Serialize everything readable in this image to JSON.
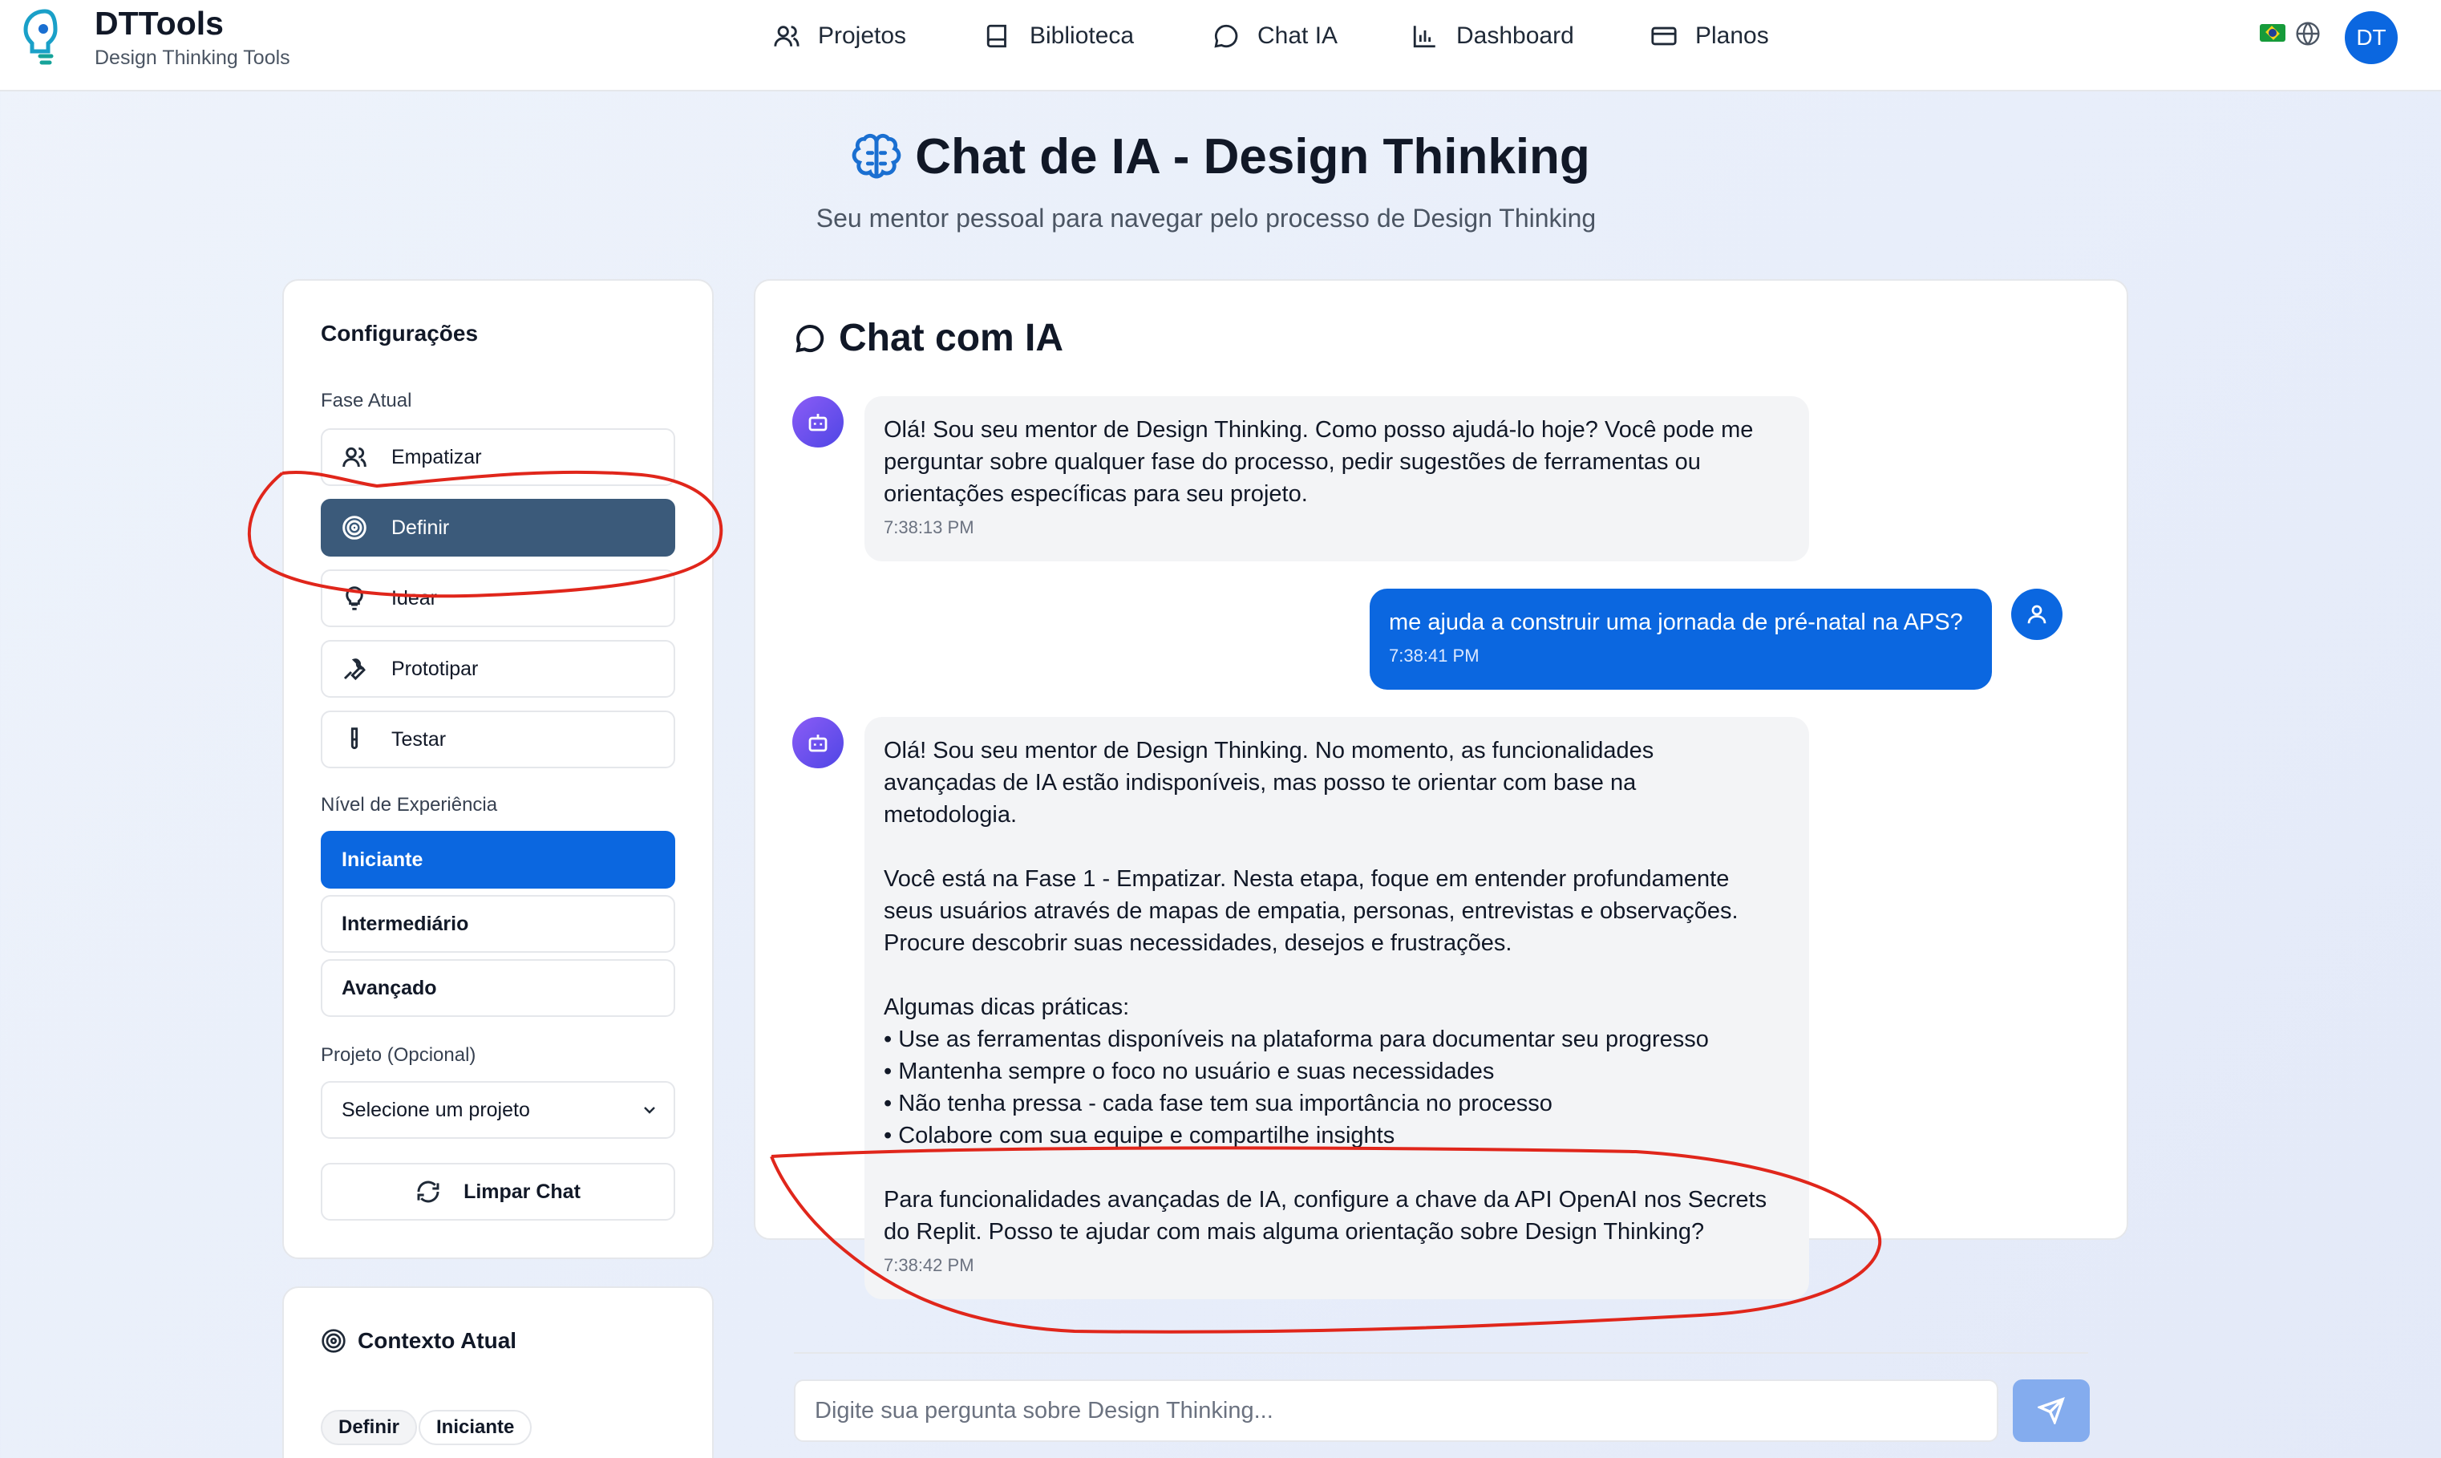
{
  "header": {
    "brand": "DTTools",
    "tagline": "Design Thinking Tools",
    "nav": [
      {
        "label": "Projetos",
        "icon": "users-icon"
      },
      {
        "label": "Biblioteca",
        "icon": "book-icon"
      },
      {
        "label": "Chat IA",
        "icon": "chat-bubble-icon"
      },
      {
        "label": "Dashboard",
        "icon": "bar-chart-icon"
      },
      {
        "label": "Planos",
        "icon": "credit-card-icon"
      }
    ],
    "avatar_initials": "DT"
  },
  "page": {
    "title": "Chat de IA - Design Thinking",
    "subtitle": "Seu mentor pessoal para navegar pelo processo de Design Thinking"
  },
  "config": {
    "heading": "Configurações",
    "phase_label": "Fase Atual",
    "phases": [
      {
        "label": "Empatizar",
        "icon": "users-icon",
        "active": false
      },
      {
        "label": "Definir",
        "icon": "target-icon",
        "active": true
      },
      {
        "label": "Idear",
        "icon": "lightbulb-icon",
        "active": false
      },
      {
        "label": "Prototipar",
        "icon": "wrench-icon",
        "active": false
      },
      {
        "label": "Testar",
        "icon": "test-tube-icon",
        "active": false
      }
    ],
    "level_label": "Nível de Experiência",
    "levels": [
      {
        "label": "Iniciante",
        "selected": true
      },
      {
        "label": "Intermediário",
        "selected": false
      },
      {
        "label": "Avançado",
        "selected": false
      }
    ],
    "project_label": "Projeto (Opcional)",
    "project_select": "Selecione um projeto",
    "clear_label": "Limpar Chat"
  },
  "context": {
    "heading": "Contexto Atual",
    "chips": [
      "Definir",
      "Iniciante"
    ]
  },
  "chat": {
    "heading": "Chat com IA",
    "messages": [
      {
        "role": "bot",
        "text": "Olá! Sou seu mentor de Design Thinking. Como posso ajudá-lo hoje? Você pode me\nperguntar sobre qualquer fase do processo, pedir sugestões de ferramentas ou\norientações específicas para seu projeto.",
        "time": "7:38:13 PM"
      },
      {
        "role": "user",
        "text": "me ajuda a construir uma jornada de pré-natal na APS?",
        "time": "7:38:41 PM"
      },
      {
        "role": "bot",
        "text": "Olá! Sou seu mentor de Design Thinking. No momento, as funcionalidades\navançadas de IA estão indisponíveis, mas posso te orientar com base na\nmetodologia.\n\nVocê está na Fase 1 - Empatizar. Nesta etapa, foque em entender profundamente\nseus usuários através de mapas de empatia, personas, entrevistas e observações.\nProcure descobrir suas necessidades, desejos e frustrações.\n\nAlgumas dicas práticas:\n• Use as ferramentas disponíveis na plataforma para documentar seu progresso\n• Mantenha sempre o foco no usuário e suas necessidades\n• Não tenha pressa - cada fase tem sua importância no processo\n• Colabore com sua equipe e compartilhe insights\n\nPara funcionalidades avançadas de IA, configure a chave da API OpenAI nos Secrets\ndo Replit. Posso te ajudar com mais alguma orientação sobre Design Thinking?",
        "time": "7:38:42 PM"
      }
    ],
    "input_placeholder": "Digite sua pergunta sobre Design Thinking..."
  },
  "colors": {
    "primary": "#0b67e0",
    "active_phase": "#3b5a7a",
    "annotation": "#e0261b",
    "bot_avatar": "#6d4fe8"
  }
}
